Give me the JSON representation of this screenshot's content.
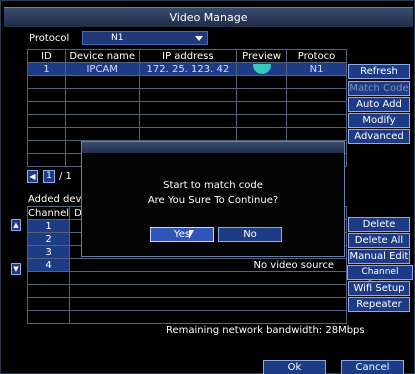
{
  "window": {
    "title": "Video Manage"
  },
  "protocol": {
    "label": "Protocol",
    "value": "N1"
  },
  "device_table": {
    "headers": [
      "ID",
      "Device name",
      "IP address",
      "Preview",
      "Protoco"
    ],
    "rows": [
      {
        "id": "1",
        "name": "IPCAM",
        "ip": "172. 25. 123. 42",
        "preview": "preview-eye-icon",
        "protocol": "N1"
      }
    ],
    "empty_rows": 7
  },
  "side_buttons": [
    "Refresh",
    "Match Code",
    "Auto Add",
    "Modify",
    "Advanced"
  ],
  "pager": {
    "page": "1",
    "separator": "/ 1"
  },
  "added_devices_label": "Added devic",
  "channel_table": {
    "headers": [
      "Channel",
      "De"
    ],
    "rows": [
      {
        "channel": "1",
        "status": ""
      },
      {
        "channel": "2",
        "status": ""
      },
      {
        "channel": "3",
        "status": ""
      },
      {
        "channel": "4",
        "status": "No video source"
      }
    ],
    "empty_rows": 4
  },
  "channel_buttons": [
    "Delete",
    "Delete All",
    "Manual Edit",
    "Channel Setup",
    "Wifi Setup",
    "Repeater"
  ],
  "bandwidth": {
    "label": "Remaining network bandwidth:",
    "value": "28Mbps"
  },
  "bottom_buttons": {
    "ok": "Ok",
    "cancel": "Cancel"
  },
  "dialog": {
    "line1": "Start to match code",
    "line2": "Are You Sure To Continue?",
    "yes": "Yes",
    "no": "No"
  },
  "colors": {
    "accent": "#1e3c86",
    "border": "#8fa8e6",
    "preview": "#37c8c0"
  }
}
